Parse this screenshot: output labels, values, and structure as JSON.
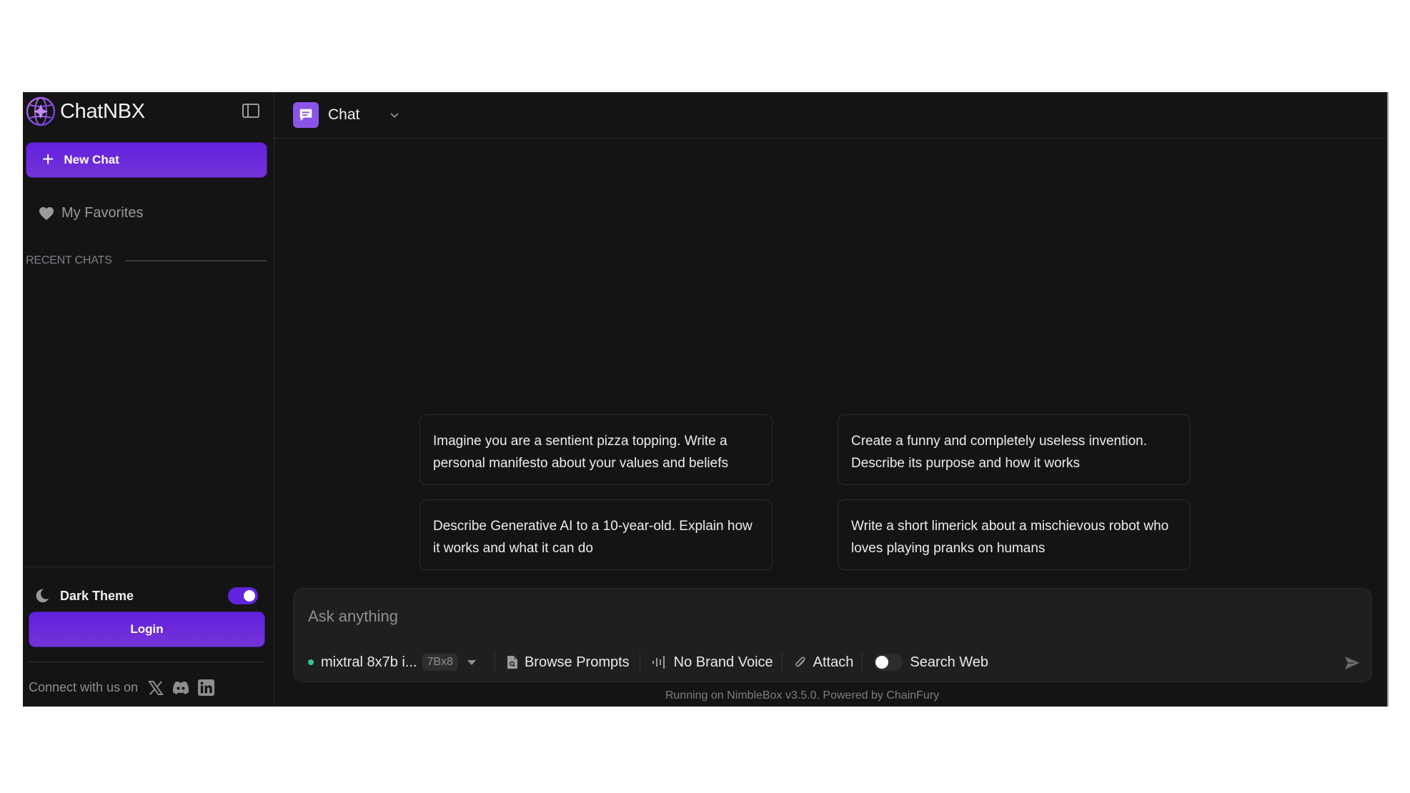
{
  "app": {
    "brand_name": "ChatNBX",
    "accent_color": "#6a2ae0"
  },
  "sidebar": {
    "new_chat_label": "New Chat",
    "favorites_label": "My Favorites",
    "recent_chats_label": "RECENT CHATS",
    "recent_chats": [],
    "theme_label": "Dark Theme",
    "dark_theme_enabled": true,
    "login_label": "Login",
    "connect_label": "Connect with us on",
    "socials": [
      "x-icon",
      "discord-icon",
      "linkedin-icon"
    ]
  },
  "header": {
    "title": "Chat"
  },
  "suggestions": [
    "Imagine you are a sentient pizza topping. Write a personal manifesto about your values and beliefs",
    "Create a funny and completely useless invention. Describe its purpose and how it works",
    "Describe Generative AI to a 10-year-old. Explain how it works and what it can do",
    "Write a short limerick about a mischievous robot who loves playing pranks on humans"
  ],
  "composer": {
    "placeholder": "Ask anything",
    "value": "",
    "model_name": "mixtral 8x7b i...",
    "model_badge": "7Bx8",
    "model_status_color": "#3ec28b",
    "browse_prompts_label": "Browse Prompts",
    "brand_voice_label": "No Brand Voice",
    "attach_label": "Attach",
    "search_web_label": "Search Web",
    "search_web_enabled": false
  },
  "footer": {
    "powered_by": "Running on NimbleBox v3.5.0. Powered by ChainFury"
  }
}
